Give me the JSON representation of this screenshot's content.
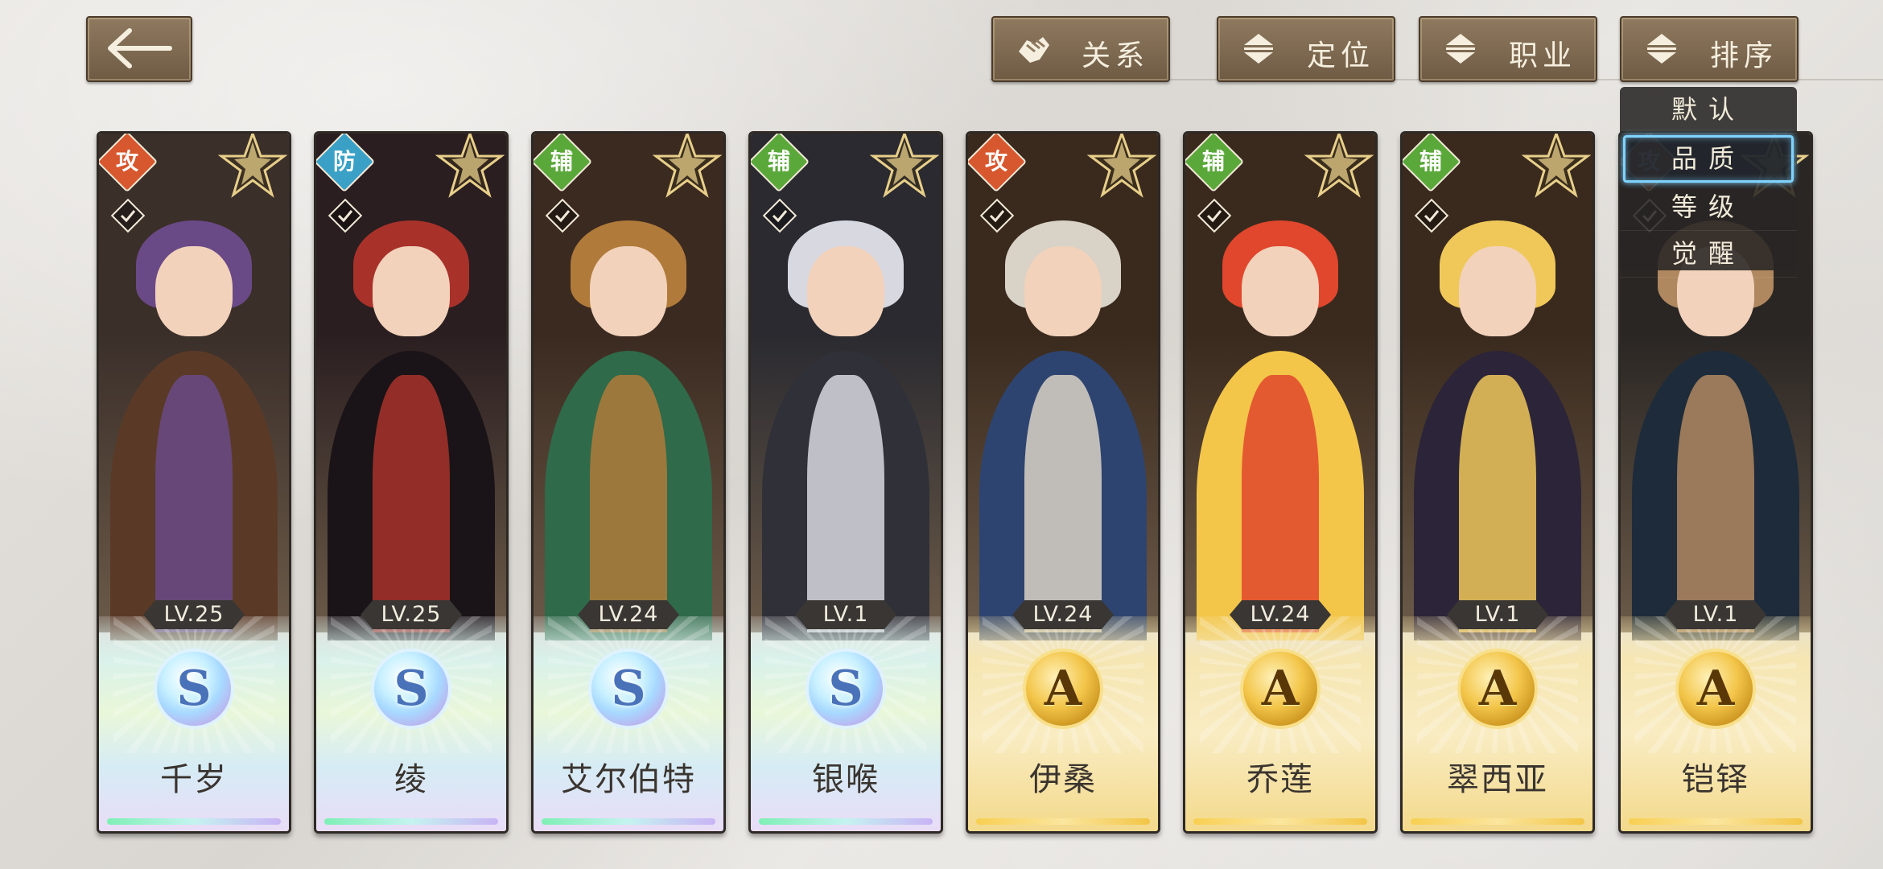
{
  "top_bar": {
    "relation_label": "关系",
    "position_label": "定位",
    "job_label": "职业",
    "sort_label": "排序"
  },
  "sort_menu": {
    "options": [
      "默认",
      "品质",
      "等级",
      "觉醒"
    ],
    "selected": "品质"
  },
  "cards": [
    {
      "name": "千岁",
      "level": "LV.25",
      "role": "攻",
      "grade": "S",
      "palette": [
        "#3b2f2a",
        "#6a4a86",
        "#5a3a26"
      ]
    },
    {
      "name": "绫",
      "level": "LV.25",
      "role": "防",
      "grade": "S",
      "palette": [
        "#2a1e20",
        "#a8322a",
        "#1a1418"
      ]
    },
    {
      "name": "艾尔伯特",
      "level": "LV.24",
      "role": "辅",
      "grade": "S",
      "palette": [
        "#3b2a20",
        "#b07a3a",
        "#2f6a4a"
      ]
    },
    {
      "name": "银喉",
      "level": "LV.1",
      "role": "辅",
      "grade": "S",
      "palette": [
        "#2a2a30",
        "#d8d8e0",
        "#303038"
      ]
    },
    {
      "name": "伊桑",
      "level": "LV.24",
      "role": "攻",
      "grade": "A",
      "palette": [
        "#3a2a1e",
        "#d9d2c6",
        "#2e4470"
      ]
    },
    {
      "name": "乔莲",
      "level": "LV.24",
      "role": "辅",
      "grade": "A",
      "palette": [
        "#3a2a1e",
        "#e0472c",
        "#f3c64a"
      ]
    },
    {
      "name": "翠西亚",
      "level": "LV.1",
      "role": "辅",
      "grade": "A",
      "palette": [
        "#3a2a1e",
        "#f0c85a",
        "#2c2438"
      ]
    },
    {
      "name": "铠铎",
      "level": "LV.1",
      "role": "攻",
      "grade": "A",
      "palette": [
        "#2a2624",
        "#b08860",
        "#1e2b3a"
      ]
    }
  ]
}
